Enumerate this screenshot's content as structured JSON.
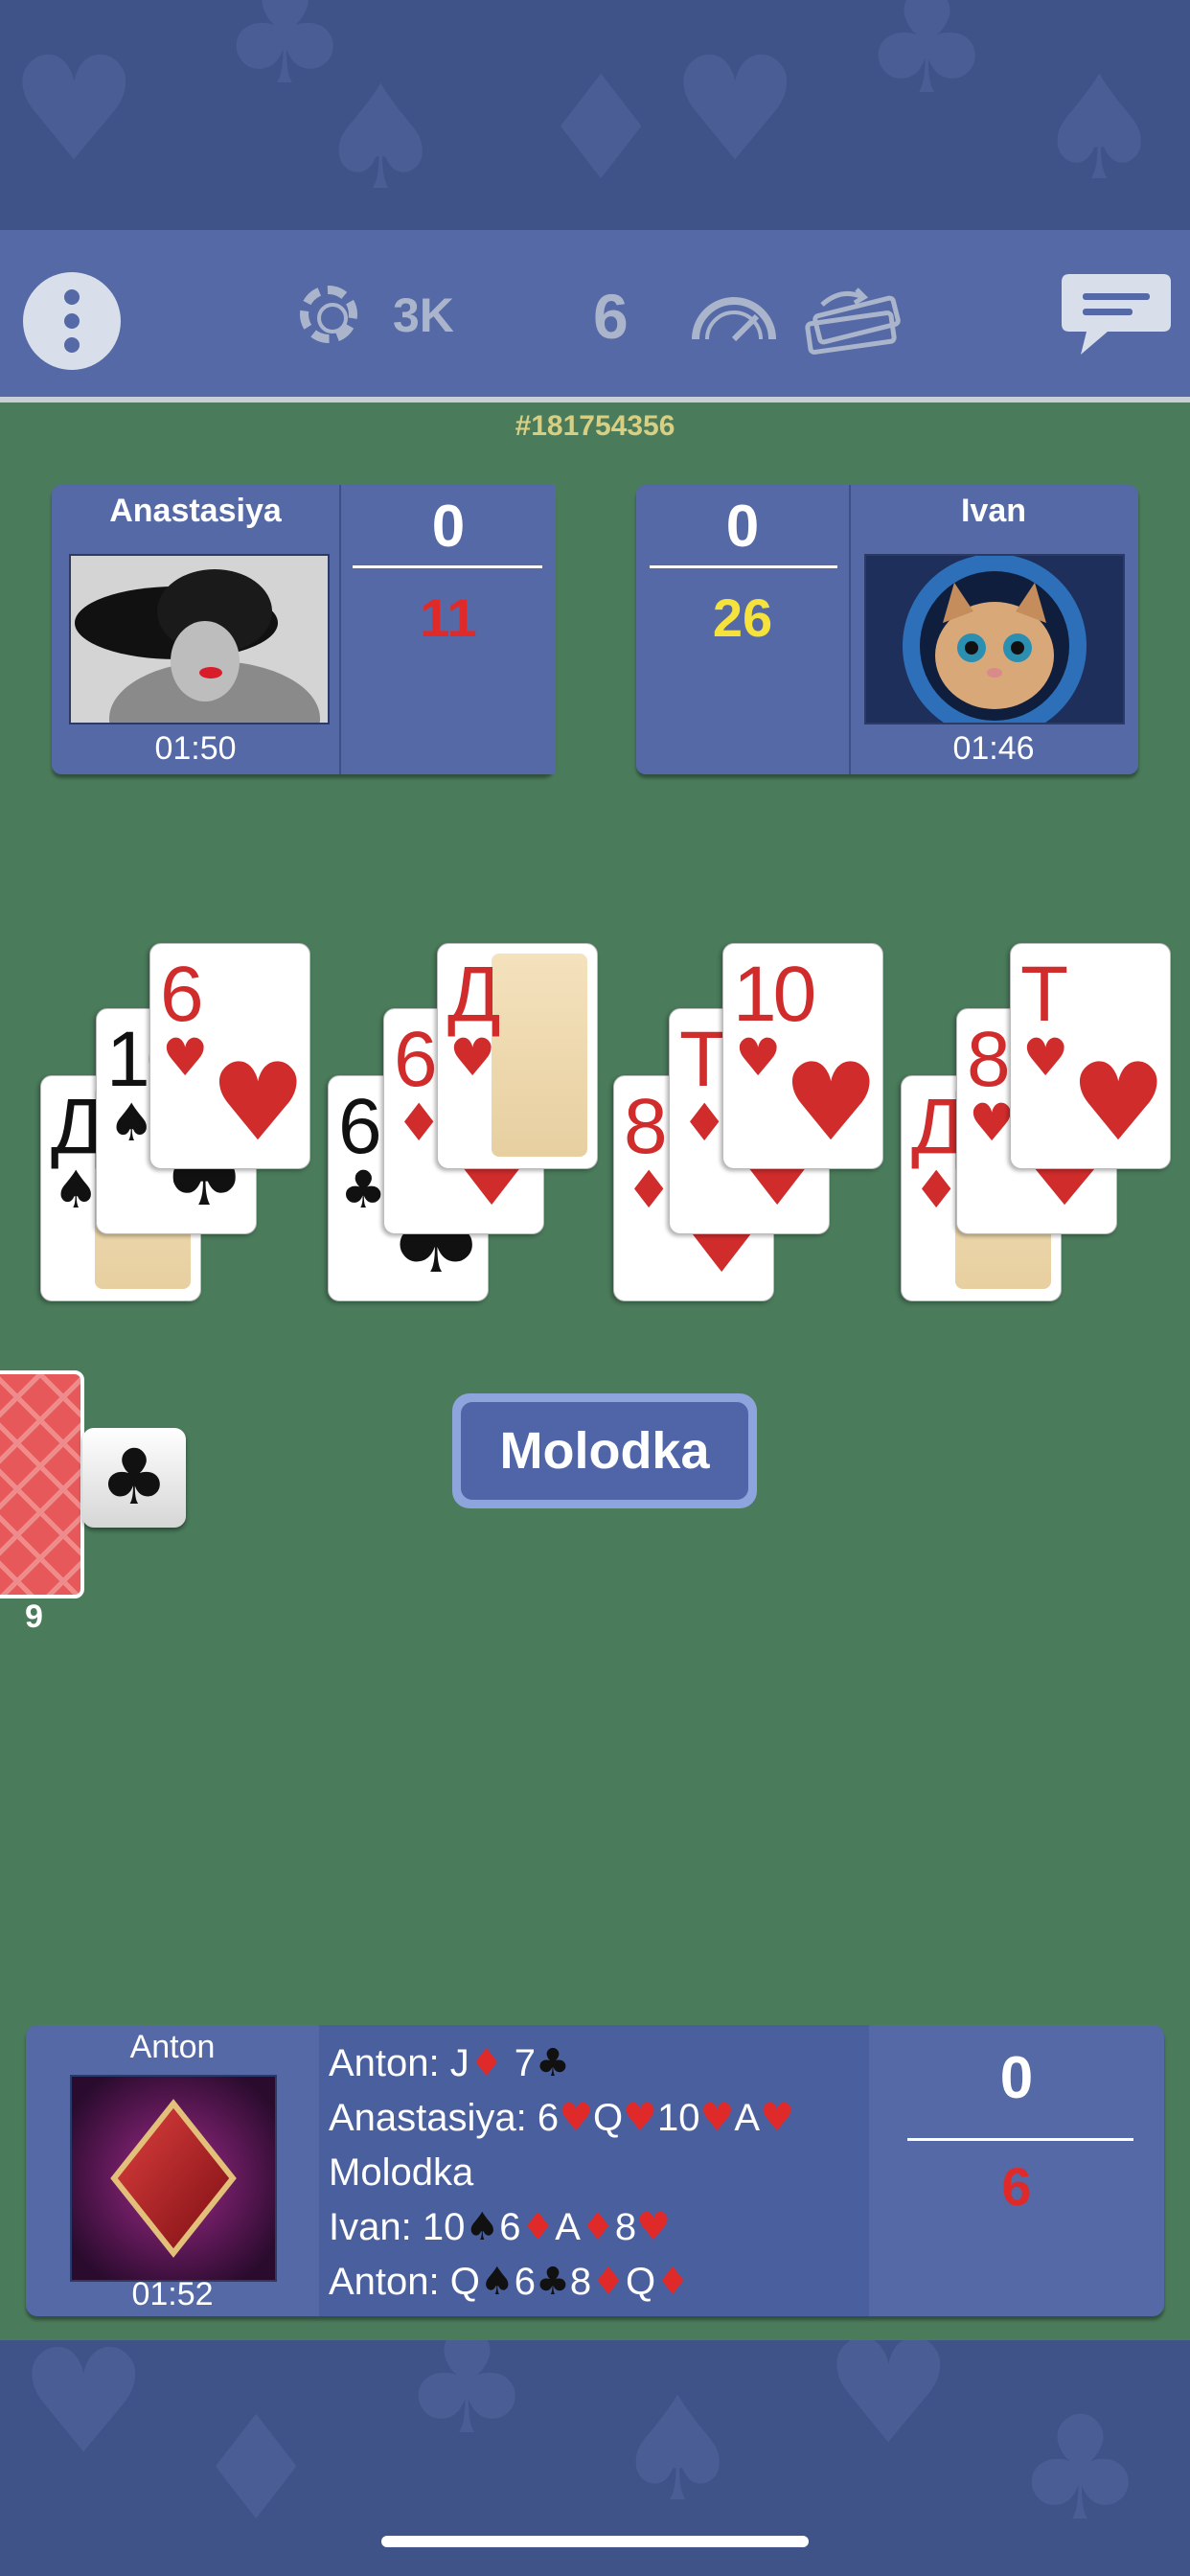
{
  "header": {
    "coins": "3K",
    "deck_count": "6",
    "game_id": "#181754356"
  },
  "opponents": [
    {
      "name": "Anastasiya",
      "time": "01:50",
      "score_top": "0",
      "score_bottom": "11",
      "score_bottom_color": "#e02a2a"
    },
    {
      "name": "Ivan",
      "time": "01:46",
      "score_top": "0",
      "score_bottom": "26",
      "score_bottom_color": "#f6e23c"
    }
  ],
  "table": {
    "piles": [
      {
        "cards": [
          {
            "rank": "Д",
            "suit": "♠",
            "color": "black",
            "face": true
          },
          {
            "rank": "10",
            "suit": "♠",
            "color": "black"
          },
          {
            "rank": "6",
            "suit": "♥",
            "color": "red"
          }
        ]
      },
      {
        "cards": [
          {
            "rank": "6",
            "suit": "♣",
            "color": "black"
          },
          {
            "rank": "6",
            "suit": "♦",
            "color": "red"
          },
          {
            "rank": "Д",
            "suit": "♥",
            "color": "red",
            "face": true
          }
        ]
      },
      {
        "cards": [
          {
            "rank": "8",
            "suit": "♦",
            "color": "red"
          },
          {
            "rank": "Т",
            "suit": "♦",
            "color": "red"
          },
          {
            "rank": "10",
            "suit": "♥",
            "color": "red"
          }
        ]
      },
      {
        "cards": [
          {
            "rank": "Д",
            "suit": "♦",
            "color": "red",
            "face": true
          },
          {
            "rank": "8",
            "suit": "♥",
            "color": "red"
          },
          {
            "rank": "Т",
            "suit": "♥",
            "color": "red"
          }
        ]
      }
    ],
    "deck_remaining": "9",
    "trump_suit": "♣",
    "announcement": "Molodka"
  },
  "me": {
    "name": "Anton",
    "time": "01:52",
    "score_top": "0",
    "score_bottom": "6",
    "log": [
      [
        {
          "t": "Anton: J"
        },
        {
          "s": "♦",
          "c": "red"
        },
        {
          "t": " 7"
        },
        {
          "s": "♣",
          "c": "black"
        }
      ],
      [
        {
          "t": "Anastasiya: 6"
        },
        {
          "s": "♥",
          "c": "red"
        },
        {
          "t": "Q"
        },
        {
          "s": "♥",
          "c": "red"
        },
        {
          "t": "10"
        },
        {
          "s": "♥",
          "c": "red"
        },
        {
          "t": "A"
        },
        {
          "s": "♥",
          "c": "red"
        }
      ],
      [
        {
          "t": "Molodka"
        }
      ],
      [
        {
          "t": "Ivan: 10"
        },
        {
          "s": "♠",
          "c": "black"
        },
        {
          "t": "6"
        },
        {
          "s": "♦",
          "c": "red"
        },
        {
          "t": "A"
        },
        {
          "s": "♦",
          "c": "red"
        },
        {
          "t": "8"
        },
        {
          "s": "♥",
          "c": "red"
        }
      ],
      [
        {
          "t": "Anton: Q"
        },
        {
          "s": "♠",
          "c": "black"
        },
        {
          "t": "6"
        },
        {
          "s": "♣",
          "c": "black"
        },
        {
          "t": "8"
        },
        {
          "s": "♦",
          "c": "red"
        },
        {
          "t": "Q"
        },
        {
          "s": "♦",
          "c": "red"
        }
      ]
    ]
  }
}
